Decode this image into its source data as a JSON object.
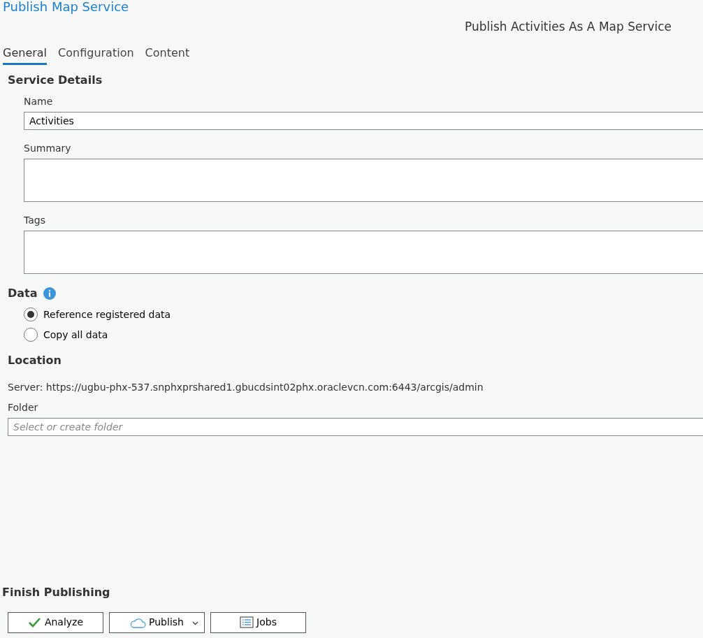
{
  "window": {
    "title": "Publish Map Service"
  },
  "subtitle": "Publish Activities As A Map Service",
  "tabs": [
    {
      "label": "General",
      "selected": true
    },
    {
      "label": "Configuration",
      "selected": false
    },
    {
      "label": "Content",
      "selected": false
    }
  ],
  "service_details": {
    "heading": "Service Details",
    "fields": [
      {
        "label": "Name",
        "value": "Activities",
        "kind": "input"
      },
      {
        "label": "Summary",
        "kind": "textarea"
      },
      {
        "label": "Tags",
        "kind": "textarea"
      }
    ]
  },
  "data": {
    "heading": "Data",
    "options": [
      {
        "label": "Reference registered data",
        "selected": true
      },
      {
        "label": "Copy all data",
        "selected": false
      }
    ]
  },
  "location": {
    "heading": "Location",
    "server": "Server: https://ugbu-phx-537.snphxprshared1.gbucdsint02phx.oraclevcn.com:6443/arcgis/admin",
    "folder_label": "Folder",
    "folder_placeholder": "Select or create folder"
  },
  "finish": {
    "heading": "Finish Publishing",
    "buttons": [
      {
        "label": "Analyze",
        "kind": "analyze"
      },
      {
        "label": "Publish",
        "kind": "publish"
      },
      {
        "label": "Jobs",
        "kind": "jobs"
      }
    ]
  }
}
